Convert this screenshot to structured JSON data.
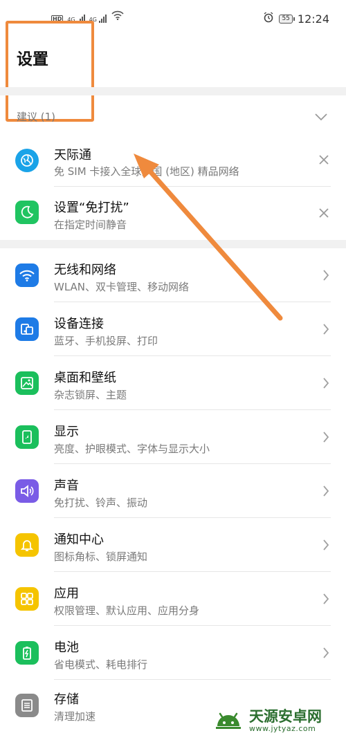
{
  "status_bar": {
    "hd_label": "HD",
    "net_left": "4G",
    "net_right": "4G",
    "battery": "55",
    "time": "12:24"
  },
  "page": {
    "title": "设置"
  },
  "suggestions": {
    "header": "建议 (1)",
    "items": [
      {
        "title": "天际通",
        "subtitle": "免 SIM 卡接入全球多国 (地区) 精品网络",
        "icon": "globe-icon",
        "color": "#1aa3e8"
      },
      {
        "title": "设置“免打扰”",
        "subtitle": "在指定时间静音",
        "icon": "moon-icon",
        "color": "#20c461"
      }
    ]
  },
  "settings": [
    {
      "title": "无线和网络",
      "subtitle": "WLAN、双卡管理、移动网络",
      "icon": "wifi-icon",
      "color": "#1e7be6"
    },
    {
      "title": "设备连接",
      "subtitle": "蓝牙、手机投屏、打印",
      "icon": "device-connect-icon",
      "color": "#1e7be6"
    },
    {
      "title": "桌面和壁纸",
      "subtitle": "杂志锁屏、主题",
      "icon": "wallpaper-icon",
      "color": "#1bbf5c"
    },
    {
      "title": "显示",
      "subtitle": "亮度、护眼模式、字体与显示大小",
      "icon": "display-icon",
      "color": "#1bbf5c"
    },
    {
      "title": "声音",
      "subtitle": "免打扰、铃声、振动",
      "icon": "sound-icon",
      "color": "#7a5ce6"
    },
    {
      "title": "通知中心",
      "subtitle": "图标角标、锁屏通知",
      "icon": "bell-icon",
      "color": "#f5c400"
    },
    {
      "title": "应用",
      "subtitle": "权限管理、默认应用、应用分身",
      "icon": "apps-grid-icon",
      "color": "#f5c400"
    },
    {
      "title": "电池",
      "subtitle": "省电模式、耗电排行",
      "icon": "battery-icon",
      "color": "#1bbf5c"
    },
    {
      "title": "存储",
      "subtitle": "清理加速",
      "icon": "storage-icon",
      "color": "#8a8a8a"
    }
  ],
  "watermark": {
    "title": "天源安卓网",
    "url": "www.jytyaz.com"
  },
  "annotation_color": "#ef8a3d"
}
